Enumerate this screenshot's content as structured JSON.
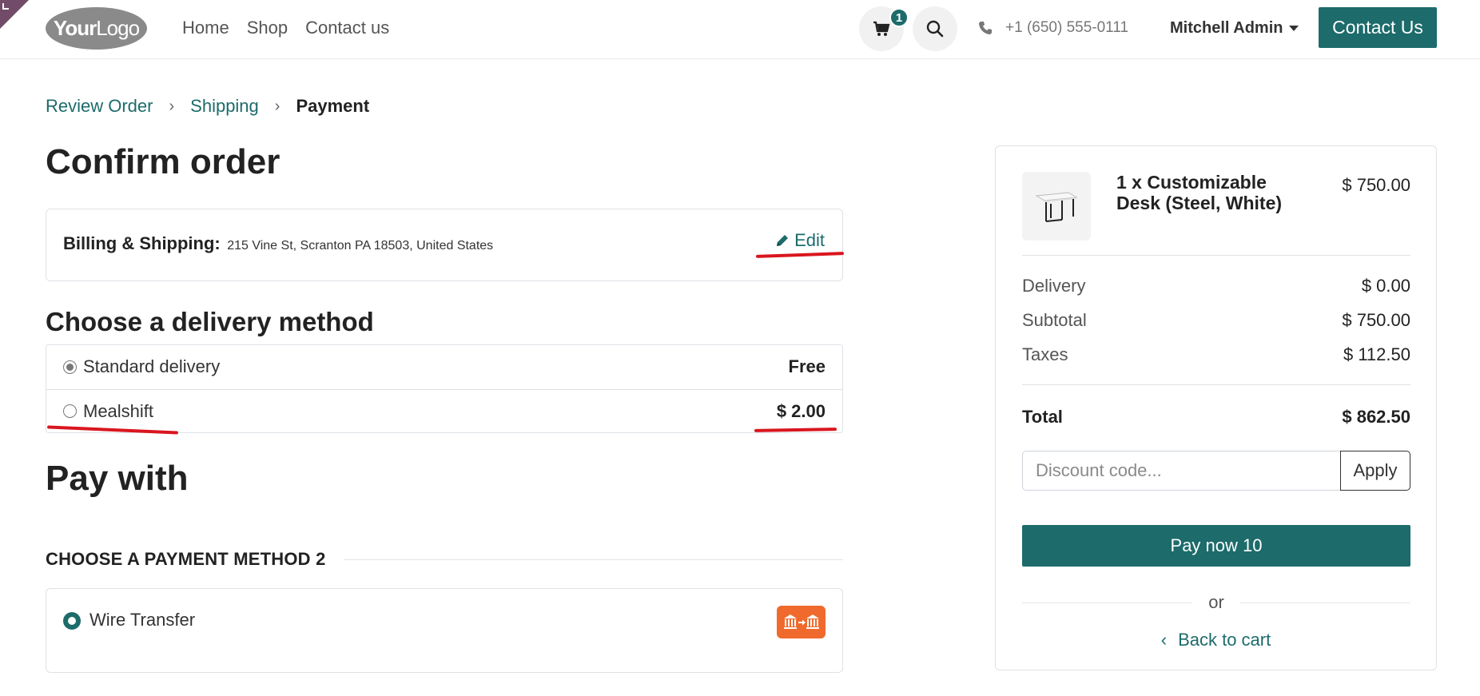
{
  "header": {
    "logo": {
      "part1": "Your",
      "part2": "Logo"
    },
    "nav": [
      "Home",
      "Shop",
      "Contact us"
    ],
    "cart_count": "1",
    "phone": "+1 (650) 555-0111",
    "user": "Mitchell Admin",
    "contact_button": "Contact Us",
    "accent_color": "#1d6b6b"
  },
  "breadcrumb": {
    "step1": "Review Order",
    "step2": "Shipping",
    "step3": "Payment"
  },
  "page_title": "Confirm order",
  "billing": {
    "label": "Billing & Shipping:",
    "address": "215 Vine St, Scranton PA 18503, United States",
    "edit": "Edit"
  },
  "delivery": {
    "title": "Choose a delivery method",
    "methods": [
      {
        "label": "Standard delivery",
        "price": "Free",
        "selected": true
      },
      {
        "label": "Mealshift",
        "price": "$ 2.00",
        "selected": false
      }
    ]
  },
  "payment": {
    "title": "Pay with",
    "heading": "CHOOSE A PAYMENT METHOD 2",
    "method": "Wire Transfer",
    "method_icon": "bank-transfer-icon"
  },
  "summary": {
    "product_name": "1 x Customizable Desk (Steel, White)",
    "product_price": "$ 750.00",
    "delivery_label": "Delivery",
    "delivery_value": "$ 0.00",
    "subtotal_label": "Subtotal",
    "subtotal_value": "$ 750.00",
    "taxes_label": "Taxes",
    "taxes_value": "$ 112.50",
    "total_label": "Total",
    "total_value": "$ 862.50",
    "discount_placeholder": "Discount code...",
    "apply": "Apply",
    "pay_now": "Pay now 10",
    "or": "or",
    "back_to_cart": "Back to cart"
  }
}
